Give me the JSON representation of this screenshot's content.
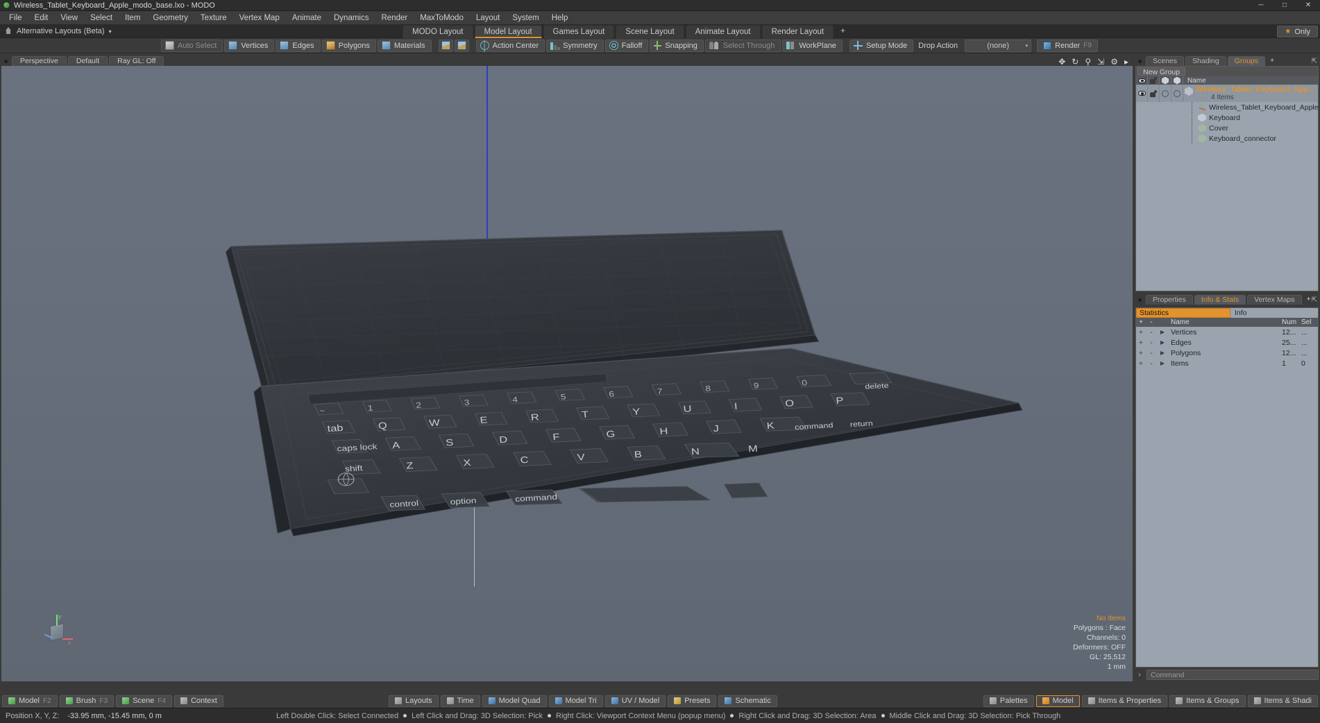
{
  "window": {
    "title": "Wireless_Tablet_Keyboard_Apple_modo_base.lxo - MODO",
    "logo_icon": "modo-logo-icon",
    "minimize": "─",
    "maximize": "□",
    "close": "✕"
  },
  "menu": {
    "items": [
      "File",
      "Edit",
      "View",
      "Select",
      "Item",
      "Geometry",
      "Texture",
      "Vertex Map",
      "Animate",
      "Dynamics",
      "Render",
      "MaxToModo",
      "Layout",
      "System",
      "Help"
    ]
  },
  "layoutbar": {
    "pin_icon": "pin-icon",
    "alternative_layouts": "Alternative Layouts (Beta)",
    "caret": "▾",
    "tabs": [
      {
        "label": "MODO Layout",
        "selected": false
      },
      {
        "label": "Model Layout",
        "selected": true
      },
      {
        "label": "Games Layout",
        "selected": false
      },
      {
        "label": "Scene Layout",
        "selected": false
      },
      {
        "label": "Animate Layout",
        "selected": false
      },
      {
        "label": "Render Layout",
        "selected": false
      }
    ],
    "add_tab": "+",
    "only_label": "Only",
    "only_star": "★"
  },
  "toolbar": {
    "items": [
      {
        "label": "Auto Select",
        "icon": "cube-gray-icon",
        "dim": true
      },
      {
        "label": "Vertices",
        "icon": "cube-blue-icon",
        "dim": false
      },
      {
        "label": "Edges",
        "icon": "cube-blue-icon",
        "dim": false
      },
      {
        "label": "Polygons",
        "icon": "cube-gold-icon",
        "dim": false
      },
      {
        "label": "Materials",
        "icon": "cube-blue-icon",
        "dim": false
      }
    ],
    "toggle_a": "cube-toggle-a-icon",
    "toggle_b": "cube-toggle-b-icon",
    "action_center": "Action Center",
    "symmetry": "Symmetry",
    "falloff": "Falloff",
    "snapping": "Snapping",
    "select_through": "Select Through",
    "workplane": "WorkPlane",
    "setup_mode": "Setup Mode",
    "drop_action": "Drop Action",
    "drop_action_value": "(none)",
    "render": "Render",
    "render_shortcut": "F9"
  },
  "viewport": {
    "tabs": [
      {
        "label": "Perspective"
      },
      {
        "label": "Default"
      },
      {
        "label": "Ray GL: Off"
      }
    ],
    "icons": [
      "move-icon",
      "rotate-icon",
      "zoom-icon",
      "fit-icon",
      "gear-icon",
      "arrow-right-icon"
    ],
    "gizmo": {
      "x": "x",
      "y": "y",
      "z": "z"
    },
    "stats": [
      {
        "text": "No Items",
        "accent": true
      },
      {
        "text": "Polygons : Face",
        "accent": false
      },
      {
        "text": "Channels: 0",
        "accent": false
      },
      {
        "text": "Deformers: OFF",
        "accent": false
      },
      {
        "text": "GL: 25,512",
        "accent": false
      },
      {
        "text": "1 mm",
        "accent": false
      }
    ]
  },
  "groups_panel": {
    "tabs": [
      {
        "label": "Scenes",
        "selected": false
      },
      {
        "label": "Shading",
        "selected": false
      },
      {
        "label": "Groups",
        "selected": true
      }
    ],
    "add_tab": "+",
    "expand_icon": "expand-icon",
    "new_group_button": "New Group",
    "columns": {
      "eye": "eye-icon",
      "hand": "hand-icon",
      "hex1": "hex-icon",
      "hex2": "hex-icon",
      "name": "Name"
    },
    "root": {
      "label": "Wireless_Tablet_Keyboard_App...",
      "sub": "4 Items",
      "icon": "group-hex-icon"
    },
    "children": [
      {
        "label": "Wireless_Tablet_Keyboard_Apple",
        "icon": "axis-icon"
      },
      {
        "label": "Keyboard",
        "icon": "mesh-icon"
      },
      {
        "label": "Cover",
        "icon": "mesh-green-icon"
      },
      {
        "label": "Keyboard_connector",
        "icon": "mesh-green-icon"
      }
    ]
  },
  "stats_panel": {
    "tabs": [
      {
        "label": "Properties",
        "selected": false
      },
      {
        "label": "Info & Stats",
        "selected": true
      },
      {
        "label": "Vertex Maps",
        "selected": false
      }
    ],
    "add_tab": "+",
    "expand_icon": "expand-icon",
    "filter_primary": "Statistics",
    "filter_secondary": "Info",
    "headers": {
      "plus": "+",
      "minus": "-",
      "tri": "▶",
      "name": "Name",
      "num": "Num",
      "sel": "Sel"
    },
    "rows": [
      {
        "plus": "+",
        "minus": "-",
        "tri": "▶",
        "name": "Vertices",
        "num": "12...",
        "sel": "..."
      },
      {
        "plus": "+",
        "minus": "-",
        "tri": "▶",
        "name": "Edges",
        "num": "25...",
        "sel": "..."
      },
      {
        "plus": "+",
        "minus": "-",
        "tri": "▶",
        "name": "Polygons",
        "num": "12...",
        "sel": "..."
      },
      {
        "plus": "+",
        "minus": "-",
        "tri": "▶",
        "name": "Items",
        "num": "1",
        "sel": "0"
      }
    ],
    "command_arrow": "›",
    "command_placeholder": "Command"
  },
  "bottombar": {
    "left": [
      {
        "label": "Model",
        "shortcut": "F2",
        "color": "g"
      },
      {
        "label": "Brush",
        "shortcut": "F3",
        "color": "g"
      },
      {
        "label": "Scene",
        "shortcut": "F4",
        "color": "g"
      },
      {
        "label": "Context",
        "shortcut": "",
        "color": "gray"
      }
    ],
    "center": [
      {
        "label": "Layouts",
        "color": ""
      },
      {
        "label": "Time",
        "color": ""
      },
      {
        "label": "Model Quad",
        "color": "b"
      },
      {
        "label": "Model Tri",
        "color": "b"
      },
      {
        "label": "UV / Model",
        "color": "b"
      },
      {
        "label": "Presets",
        "color": "y"
      },
      {
        "label": "Schematic",
        "color": "b"
      }
    ],
    "right": [
      {
        "label": "Palettes",
        "color": "gray",
        "selected": false
      },
      {
        "label": "Model",
        "color": "y",
        "selected": true
      },
      {
        "label": "Items & Properties",
        "color": "gray",
        "selected": false
      },
      {
        "label": "Items & Groups",
        "color": "gray",
        "selected": false
      },
      {
        "label": "Items & Shadi",
        "color": "gray",
        "selected": false
      }
    ]
  },
  "statusbar": {
    "position_label": "Position X, Y, Z:",
    "position_value": "-33.95 mm, -15.45 mm, 0 m",
    "hints": [
      "Left Double Click: Select Connected",
      "Left Click and Drag: 3D Selection: Pick",
      "Right Click: Viewport Context Menu (popup menu)",
      "Right Click and Drag: 3D Selection: Area",
      "Middle Click and Drag: 3D Selection: Pick Through"
    ]
  },
  "colors": {
    "accent": "#e0932f",
    "panel_bg": "#3a3a3a",
    "viewport_bg": "#666e7b",
    "list_bg": "#9aa3ae"
  }
}
